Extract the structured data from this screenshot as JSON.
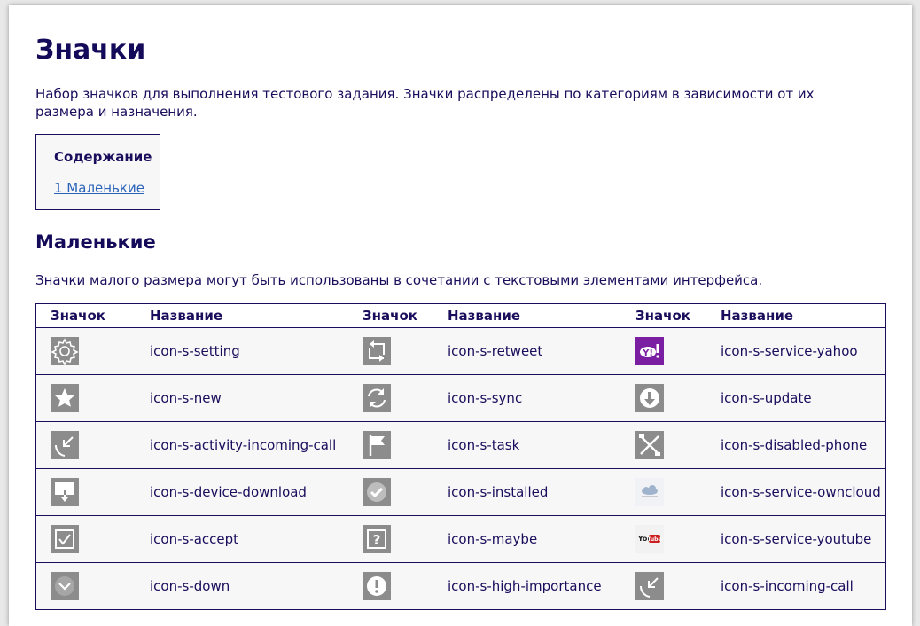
{
  "page": {
    "title": "Значки",
    "intro": "Набор значков для выполнения тестового задания. Значки распределены по категориям в зависимости от их размера и назначения."
  },
  "toc": {
    "title": "Содержание",
    "link": "1 Маленькие"
  },
  "section": {
    "title": "Маленькие",
    "description": "Значки малого размера могут быть использованы в сочетании с текстовыми элементами интерфейса."
  },
  "table": {
    "headers": [
      "Значок",
      "Название",
      "Значок",
      "Название",
      "Значок",
      "Название"
    ],
    "rows": [
      [
        {
          "icon": "gear-icon",
          "name": "icon-s-setting"
        },
        {
          "icon": "retweet-icon",
          "name": "icon-s-retweet"
        },
        {
          "icon": "yahoo-icon",
          "name": "icon-s-service-yahoo"
        }
      ],
      [
        {
          "icon": "star-icon",
          "name": "icon-s-new"
        },
        {
          "icon": "sync-icon",
          "name": "icon-s-sync"
        },
        {
          "icon": "update-icon",
          "name": "icon-s-update"
        }
      ],
      [
        {
          "icon": "incoming-call-arrow-icon",
          "name": "icon-s-activity-incoming-call"
        },
        {
          "icon": "flag-icon",
          "name": "icon-s-task"
        },
        {
          "icon": "disabled-phone-icon",
          "name": "icon-s-disabled-phone"
        }
      ],
      [
        {
          "icon": "device-download-icon",
          "name": "icon-s-device-download"
        },
        {
          "icon": "check-circle-icon",
          "name": "icon-s-installed"
        },
        {
          "icon": "owncloud-icon",
          "name": "icon-s-service-owncloud"
        }
      ],
      [
        {
          "icon": "checkbox-icon",
          "name": "icon-s-accept"
        },
        {
          "icon": "question-icon",
          "name": "icon-s-maybe"
        },
        {
          "icon": "youtube-icon",
          "name": "icon-s-service-youtube"
        }
      ],
      [
        {
          "icon": "chevron-down-icon",
          "name": "icon-s-down"
        },
        {
          "icon": "exclamation-icon",
          "name": "icon-s-high-importance"
        },
        {
          "icon": "incoming-call-icon",
          "name": "icon-s-incoming-call"
        }
      ]
    ]
  },
  "colors": {
    "text": "#1a0d5c",
    "link": "#2a63b8",
    "icon_bg": "#8c8c8c",
    "yahoo": "#7b1fa2",
    "youtube": "#cc1e1e"
  }
}
